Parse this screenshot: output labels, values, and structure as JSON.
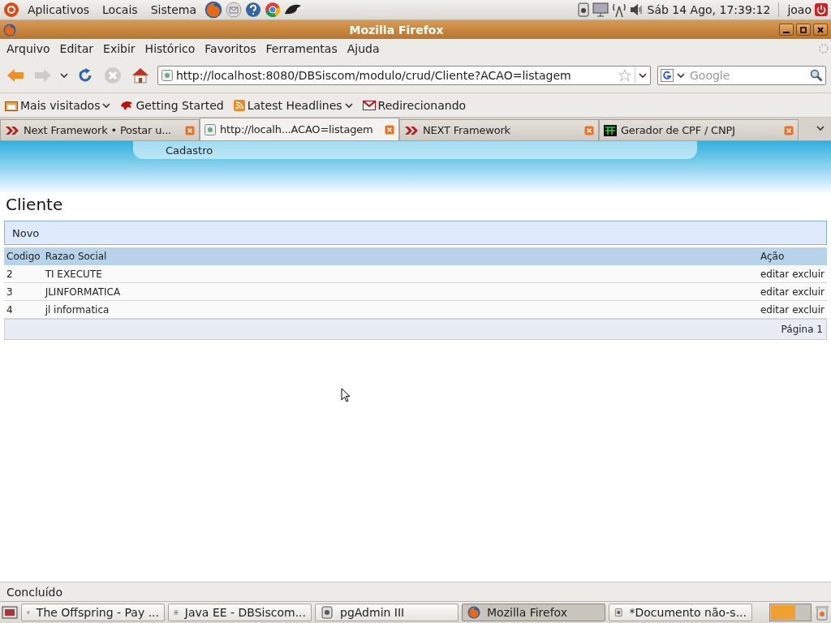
{
  "top_panel": {
    "menus": [
      "Aplicativos",
      "Locais",
      "Sistema"
    ],
    "clock": "Sáb 14 Ago, 17:39:12",
    "user": "joao"
  },
  "window": {
    "title": "Mozilla Firefox"
  },
  "menu_bar": [
    "Arquivo",
    "Editar",
    "Exibir",
    "Histórico",
    "Favoritos",
    "Ferramentas",
    "Ajuda"
  ],
  "navigation": {
    "url": "http://localhost:8080/DBSiscom/modulo/crud/Cliente?ACAO=listagem",
    "search_placeholder": "Google"
  },
  "bookmarks": [
    {
      "label": "Mais visitados",
      "has_menu": true
    },
    {
      "label": "Getting Started",
      "has_menu": false
    },
    {
      "label": "Latest Headlines",
      "has_menu": true
    },
    {
      "label": "Redirecionando",
      "has_menu": false
    }
  ],
  "tabs": [
    {
      "title": "Next Framework • Postar u...",
      "selected": false
    },
    {
      "title": "http://localh...ACAO=listagem",
      "selected": true
    },
    {
      "title": "NEXT Framework",
      "selected": false
    },
    {
      "title": "Gerador de CPF / CNPJ",
      "selected": false
    }
  ],
  "page": {
    "nav": "Cadastro",
    "heading": "Cliente",
    "new_button": "Novo",
    "table": {
      "columns": [
        "Codigo",
        "Razao Social",
        "Ação"
      ],
      "rows": [
        {
          "code": "2",
          "name": "TI EXECUTE",
          "actions": [
            "editar",
            "excluir"
          ]
        },
        {
          "code": "3",
          "name": "JLINFORMATICA",
          "actions": [
            "editar",
            "excluir"
          ]
        },
        {
          "code": "4",
          "name": "jl informatica",
          "actions": [
            "editar",
            "excluir"
          ]
        }
      ],
      "pagination": "Página 1"
    }
  },
  "status_bar": "Concluído",
  "taskbar": [
    {
      "label": "The Offspring - Pay ...",
      "selected": false
    },
    {
      "label": "Java EE - DBSiscom...",
      "selected": false
    },
    {
      "label": "pgAdmin III",
      "selected": false
    },
    {
      "label": "Mozilla Firefox",
      "selected": true
    },
    {
      "label": "*Documento não-s...",
      "selected": false
    }
  ]
}
